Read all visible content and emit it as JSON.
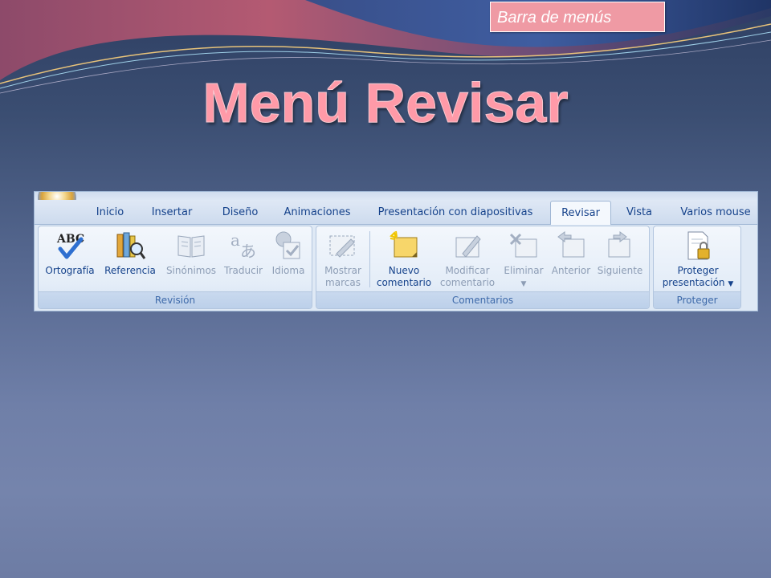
{
  "nav": {
    "label": "Barra de menús"
  },
  "slide": {
    "title": "Menú Revisar"
  },
  "ribbon": {
    "tabs": [
      {
        "label": "Inicio"
      },
      {
        "label": "Insertar"
      },
      {
        "label": "Diseño"
      },
      {
        "label": "Animaciones"
      },
      {
        "label": "Presentación con diapositivas"
      },
      {
        "label": "Revisar",
        "active": true
      },
      {
        "label": "Vista"
      },
      {
        "label": "Varios mouse"
      }
    ],
    "groups": {
      "revision": {
        "label": "Revisión",
        "buttons": [
          {
            "label": "Ortografía",
            "icon": "spellcheck-abc-icon",
            "enabled": true
          },
          {
            "label": "Referencia",
            "icon": "research-books-icon",
            "enabled": true
          },
          {
            "label": "Sinónimos",
            "icon": "thesaurus-book-icon",
            "enabled": false
          },
          {
            "label": "Traducir",
            "icon": "translate-icon",
            "enabled": false
          },
          {
            "label": "Idioma",
            "icon": "language-globe-icon",
            "enabled": false
          }
        ]
      },
      "comentarios": {
        "label": "Comentarios",
        "buttons": [
          {
            "label_line1": "Mostrar",
            "label_line2": "marcas",
            "icon": "show-markup-icon",
            "enabled": false
          },
          {
            "label_line1": "Nuevo",
            "label_line2": "comentario",
            "icon": "new-comment-icon",
            "enabled": true
          },
          {
            "label_line1": "Modificar",
            "label_line2": "comentario",
            "icon": "edit-comment-icon",
            "enabled": false
          },
          {
            "label": "Eliminar",
            "icon": "delete-comment-icon",
            "enabled": false
          },
          {
            "label": "Anterior",
            "icon": "previous-comment-icon",
            "enabled": false
          },
          {
            "label": "Siguiente",
            "icon": "next-comment-icon",
            "enabled": false
          }
        ]
      },
      "proteger": {
        "label": "Proteger",
        "buttons": [
          {
            "label_line1": "Proteger",
            "label_line2": "presentación",
            "icon": "protect-document-lock-icon",
            "enabled": true
          }
        ]
      }
    }
  },
  "colors": {
    "title_pink": "#ff9aa8",
    "nav_bg": "#ef9aa4",
    "ribbon_text": "#15428b",
    "group_label_text": "#3e6aaa"
  }
}
